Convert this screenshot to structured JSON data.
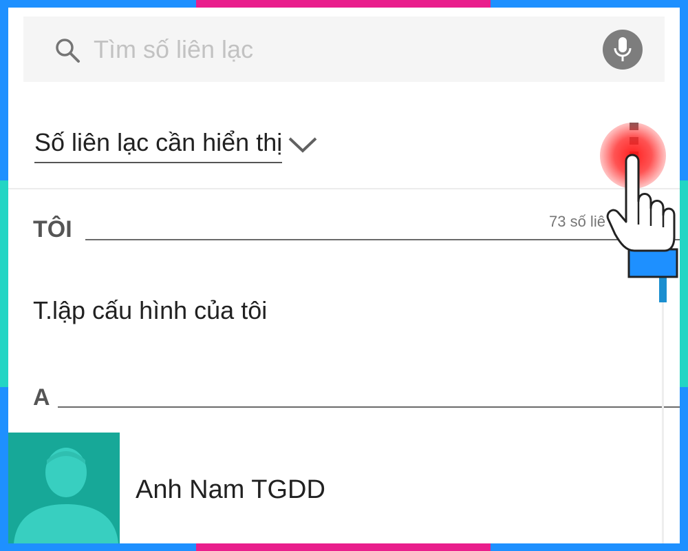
{
  "search": {
    "placeholder": "Tìm số liên lạc",
    "search_icon": "search-icon",
    "mic_icon": "microphone-icon"
  },
  "filter": {
    "label": "Số liên lạc cần hiển thị",
    "chevron_icon": "chevron-down-icon"
  },
  "menu": {
    "icon": "overflow-menu-icon"
  },
  "sections": {
    "me": {
      "header": "TÔI",
      "count": "73 số liê"
    },
    "profile_row": "T.lập cấu hình của tôi",
    "a": {
      "header": "A"
    }
  },
  "contacts": [
    {
      "name": "Anh Nam TGDD",
      "avatar_icon": "person-silhouette-icon"
    }
  ],
  "colors": {
    "accent_blue": "#1e90ff",
    "accent_pink": "#e91e8c",
    "accent_cyan": "#23d5c4",
    "avatar_teal": "#17a898",
    "tap_red": "#ff2020"
  },
  "overlay": {
    "tap_indicator_icon": "pointing-hand-icon"
  }
}
